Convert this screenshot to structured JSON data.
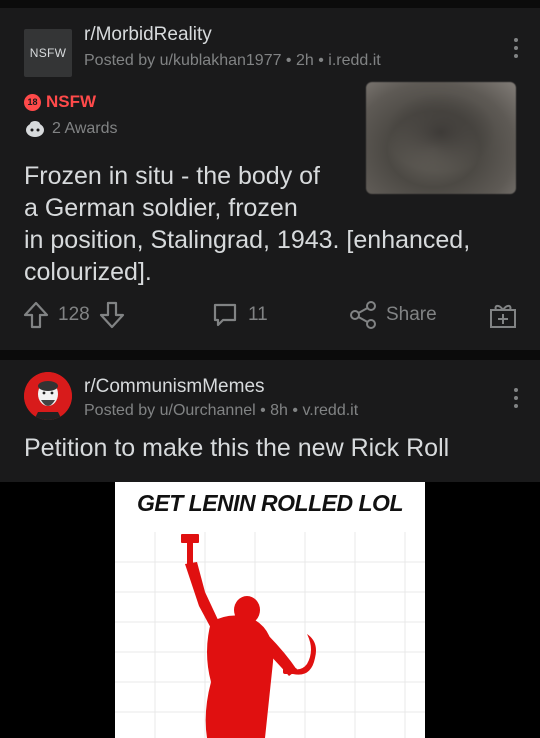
{
  "post1": {
    "subreddit": "r/MorbidReality",
    "avatar_text": "NSFW",
    "meta": "Posted by u/kublakhan1977 • 2h • i.redd.it",
    "nsfw_badge": "18",
    "nsfw_label": "NSFW",
    "awards": "2 Awards",
    "title_lines": [
      "Frozen in situ - the body of",
      "a German soldier, frozen",
      "in position, Stalingrad, 1943. [enhanced,",
      "colourized]."
    ],
    "votes": "128",
    "comments": "11",
    "share_label": "Share"
  },
  "post2": {
    "subreddit": "r/CommunismMemes",
    "meta": "Posted by u/Ourchannel • 8h • v.redd.it",
    "title": "Petition to make this the new Rick Roll",
    "media_caption": "GET LENIN ROLLED LOL"
  },
  "colors": {
    "background": "#0b0b0b",
    "card": "#1a1a1b",
    "text": "#d7dadc",
    "muted": "#818384",
    "nsfw": "#ff4a4a",
    "statue_red": "#e01010"
  }
}
